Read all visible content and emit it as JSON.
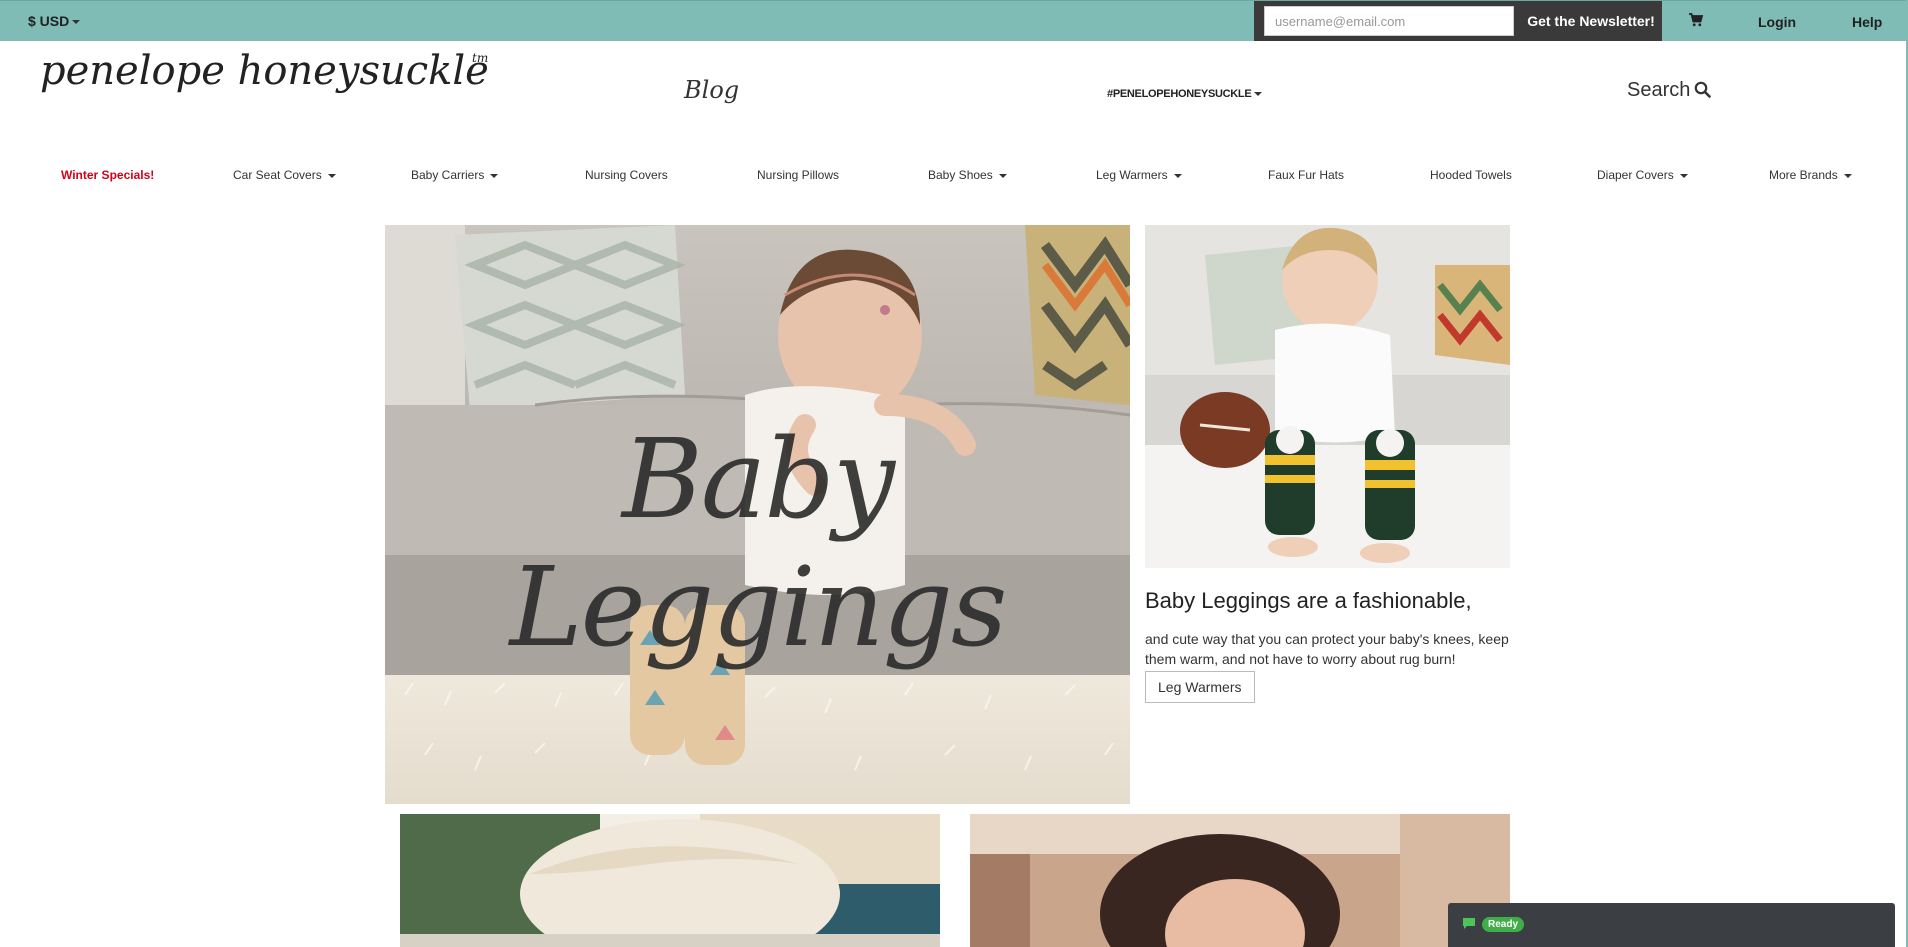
{
  "topbar": {
    "currency": "$ USD",
    "newsletter_placeholder": "username@email.com",
    "newsletter_button": "Get the Newsletter!",
    "login": "Login",
    "help": "Help"
  },
  "header": {
    "logo_text": "penelope honeysuckle",
    "logo_tm": "tm",
    "blog": "Blog",
    "hashtag": "#PENELOPEHONEYSUCKLE",
    "search": "Search"
  },
  "nav": {
    "items": [
      {
        "label": "Winter Specials!",
        "dropdown": false
      },
      {
        "label": "Car Seat Covers",
        "dropdown": true
      },
      {
        "label": "Baby Carriers",
        "dropdown": true
      },
      {
        "label": "Nursing Covers",
        "dropdown": false
      },
      {
        "label": "Nursing Pillows",
        "dropdown": false
      },
      {
        "label": "Baby Shoes",
        "dropdown": true
      },
      {
        "label": "Leg Warmers",
        "dropdown": true
      },
      {
        "label": "Faux Fur Hats",
        "dropdown": false
      },
      {
        "label": "Hooded Towels",
        "dropdown": false
      },
      {
        "label": "Diaper Covers",
        "dropdown": true
      },
      {
        "label": "More Brands",
        "dropdown": true
      }
    ]
  },
  "hero": {
    "title": "Baby Leggings"
  },
  "feature": {
    "headline": "Baby Leggings are a fashionable,",
    "description": "and cute way that you can protect your baby's knees, keep them warm, and not have to worry about rug burn!",
    "button": "Leg Warmers"
  },
  "chat": {
    "status": "Ready"
  },
  "colors": {
    "topbar": "#7fbcb5",
    "newsletter_bg": "#3a3a3a",
    "special_red": "#d0021b",
    "chat_bg": "#3b3e42",
    "chat_ready": "#3fae49"
  }
}
